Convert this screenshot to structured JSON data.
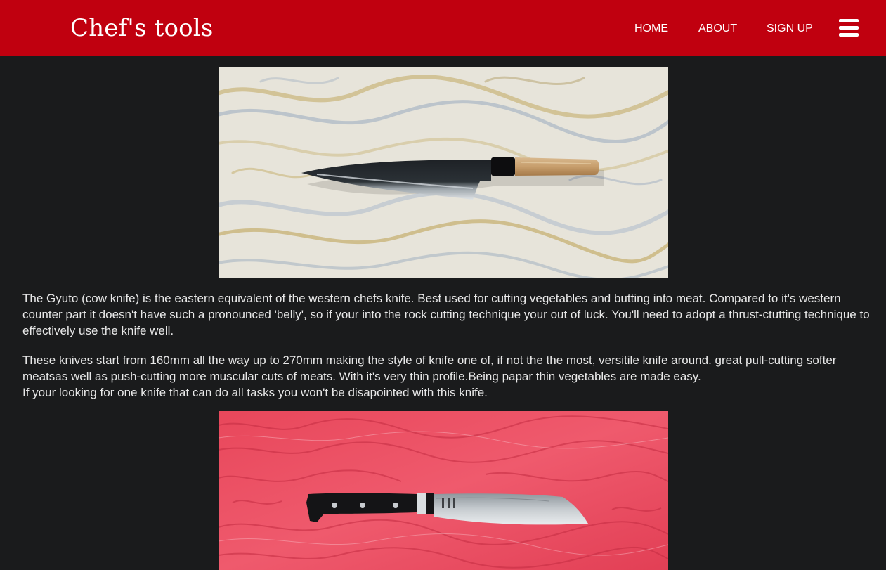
{
  "header": {
    "brand": "Chef's tools",
    "nav": {
      "home": "HOME",
      "about": "ABOUT",
      "signup": "SIGN UP"
    },
    "menu_icon": "hamburger-menu-icon",
    "background_color": "#c0000f"
  },
  "main": {
    "background_color": "#1a1b1c",
    "paragraphs": [
      "The Gyuto (cow knife) is the eastern equivalent of the western chefs knife. Best used for cutting vegetables and butting into meat. Compared to it's western counter part it doesn't have such a pronounced 'belly', so if your into the rock cutting technique your out of luck. You'll need to adopt a thrust-ctutting technique to effectively use the knife well.",
      "These knives start from 160mm all the way up to 270mm making the style of knife one of, if not the the most, versitile knife around. great pull-cutting softer meatsas well as push-cutting more muscular cuts of meats. With it's very thin profile.Being papar thin vegetables are made easy.",
      "If your looking for one knife that can do all tasks you won't be disapointed with this knife."
    ]
  }
}
